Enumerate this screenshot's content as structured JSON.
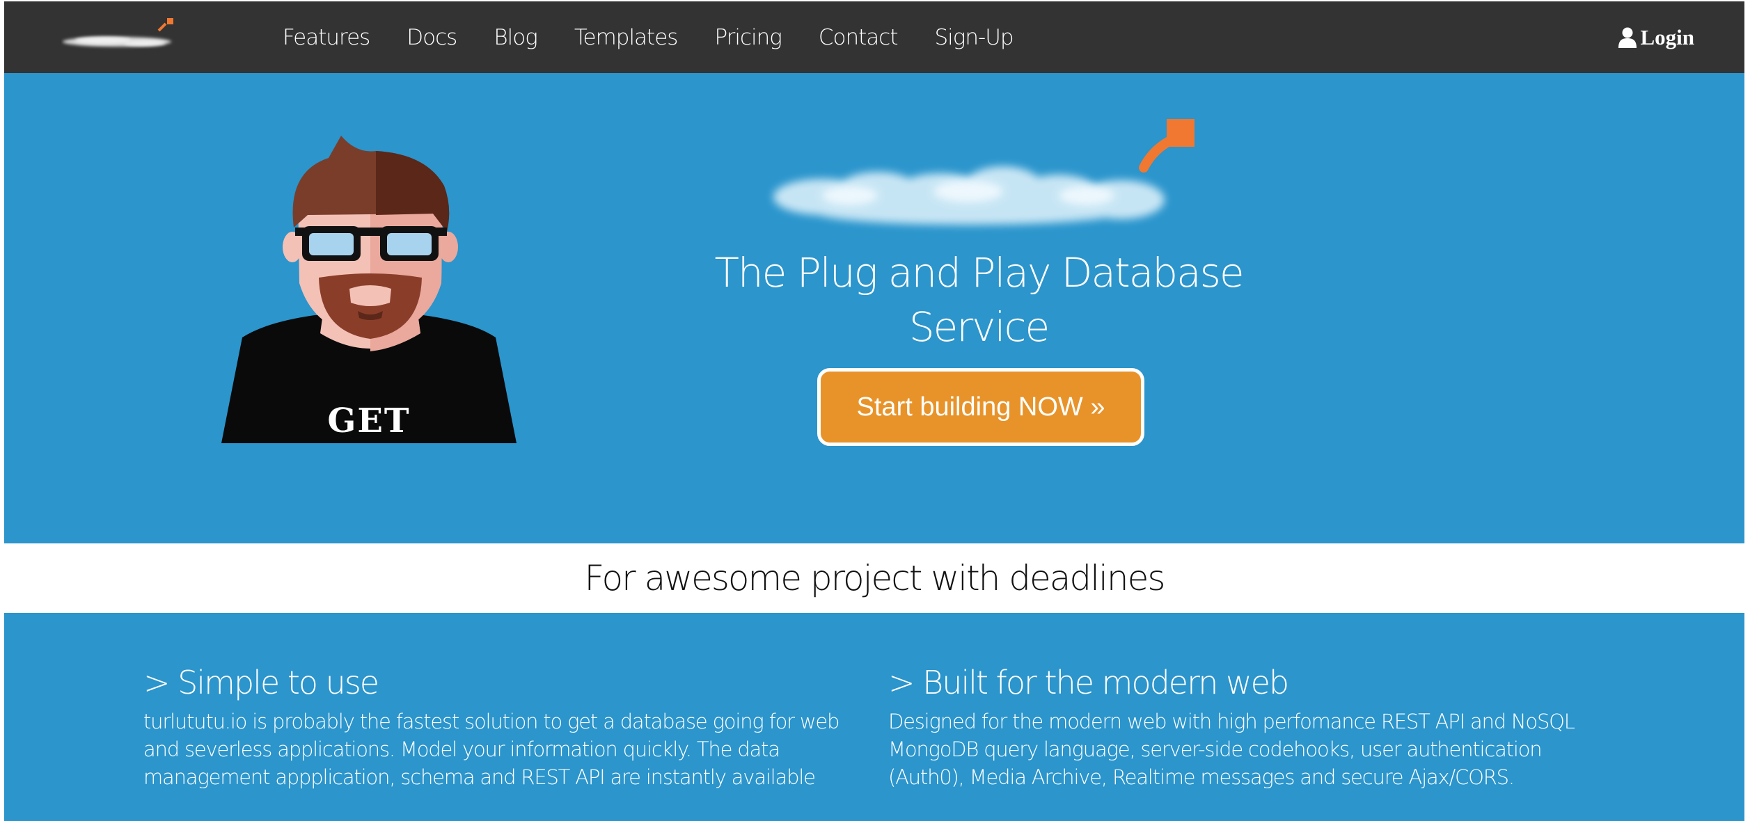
{
  "nav": {
    "links": [
      "Features",
      "Docs",
      "Blog",
      "Templates",
      "Pricing",
      "Contact",
      "Sign-Up"
    ],
    "login_label": "Login",
    "login_icon": "user-icon"
  },
  "hero": {
    "title": "The Plug and Play Database Service",
    "cta_label": "Start building NOW »",
    "mascot_shirt_text": "GET"
  },
  "tagline": "For awesome project with deadlines",
  "features": [
    {
      "heading": "> Simple to use",
      "body": "turlututu.io is probably the fastest solution to get a database going for web and severless applications. Model your information quickly. The data management appplication, schema and REST API are instantly available"
    },
    {
      "heading": "> Built for the modern web",
      "body": "Designed for the modern web with high perfomance REST API and NoSQL MongoDB query language, server-side codehooks, user authentication (Auth0), Media Archive, Realtime messages and secure Ajax/CORS."
    }
  ],
  "colors": {
    "navbar_bg": "#333333",
    "hero_bg": "#2b95cc",
    "cta_bg": "#e8932a",
    "logo_accent": "#f07830"
  }
}
